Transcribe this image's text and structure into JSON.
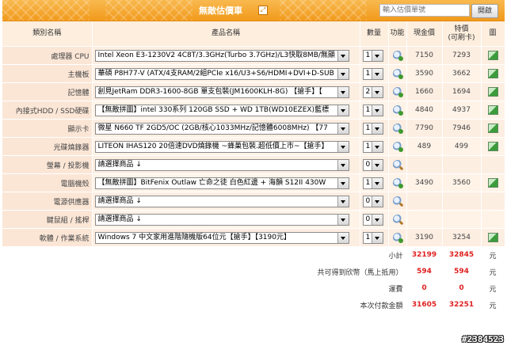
{
  "header": {
    "title": "無敵估價車",
    "search_placeholder": "輸入估價單號",
    "search_button": "開啟",
    "colors": {
      "bar": "#f3a430",
      "accent_red": "#e02020"
    }
  },
  "columns": {
    "category": "類別名稱",
    "product": "產品名稱",
    "qty": "數量",
    "function": "功能",
    "cash": "現金價",
    "card_line1": "特價",
    "card_line2": "(可刷卡)",
    "picture": "圖"
  },
  "rows": [
    {
      "category": "處理器 CPU",
      "product": "Intel Xeon E3-1230V2 4C8T/3.3GHz(Turbo 3.7GHz)/L3快取8MB/無顯",
      "qty": "1",
      "icon": "config-icon",
      "cash": "7150",
      "card": "7293"
    },
    {
      "category": "主機板",
      "product": "華碩 P8H77-V (ATX/4支RAM/2組PCIe x16/U3+S6/HDMI+DVI+D-SUB",
      "qty": "1",
      "icon": "config-icon",
      "cash": "3590",
      "card": "3662"
    },
    {
      "category": "記憶體",
      "product": "創見JetRam DDR3-1600-8GB 單支包裝(JM1600KLH-8G) 【搶手】【",
      "qty": "2",
      "icon": "config-icon",
      "cash": "1660",
      "card": "1694"
    },
    {
      "category": "內接式HDD / SSD硬碟",
      "product": "【無敵拼圖】intel 330系列 120GB SSD + WD 1TB(WD10EZEX)藍標",
      "qty": "1",
      "icon": "config-icon",
      "cash": "4840",
      "card": "4937"
    },
    {
      "category": "顯示卡",
      "product": "微星 N660 TF 2GD5/OC (2GB/核心1033MHz/記憶體6008MHz) 【77",
      "qty": "1",
      "icon": "config-icon",
      "cash": "7790",
      "card": "7946"
    },
    {
      "category": "光碟燒錄器",
      "product": "LITEON IHAS120 20倍速DVD燒錄機 ~蜂巢包裝.超低價上市~【搶手】",
      "qty": "1",
      "icon": "config-icon",
      "cash": "489",
      "card": "499"
    },
    {
      "category": "螢幕 / 投影機",
      "product": "請選擇商品 ↓",
      "qty": "0",
      "icon": "search-icon",
      "cash": "",
      "card": ""
    },
    {
      "category": "電腦機殼",
      "product": "【無敵拼圖】BitFenix Outlaw 亡命之徒 白色紅邊 + 海韻 S12II 430W",
      "qty": "1",
      "icon": "config-icon",
      "cash": "3490",
      "card": "3560"
    },
    {
      "category": "電源供應器",
      "product": "請選擇商品 ↓",
      "qty": "0",
      "icon": "search-icon",
      "cash": "",
      "card": ""
    },
    {
      "category": "鍵鼠組 / 搖桿",
      "product": "請選擇商品 ↓",
      "qty": "0",
      "icon": "search-icon",
      "cash": "",
      "card": ""
    },
    {
      "category": "軟體 / 作業系統",
      "product": "Windows 7 中文家用進階隨機版64位元【搶手】【3190元】",
      "qty": "1",
      "icon": "config-icon",
      "cash": "3190",
      "card": "3254"
    }
  ],
  "summary": [
    {
      "label": "小計",
      "cash": "32199",
      "card": "32845",
      "unit": "元"
    },
    {
      "label": "共可得到欣幣（馬上抵用）",
      "cash": "594",
      "card": "594",
      "unit": "元"
    },
    {
      "label": "運費",
      "cash": "0",
      "card": "0",
      "unit": "元"
    },
    {
      "label": "本次付款金額",
      "cash": "31605",
      "card": "32251",
      "unit": "元"
    }
  ],
  "watermark": "#2384523"
}
